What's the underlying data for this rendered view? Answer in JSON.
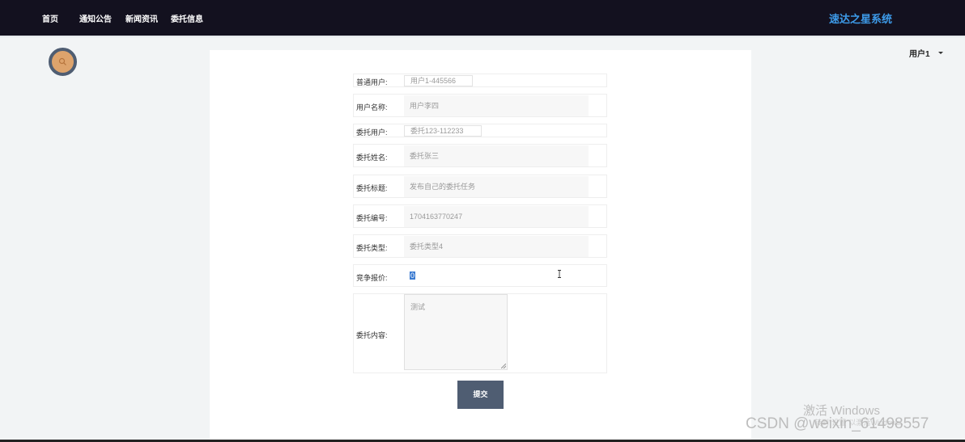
{
  "nav": {
    "items": [
      "首页",
      "通知公告",
      "新闻资讯",
      "委托信息"
    ],
    "brand": "速达之星系统"
  },
  "icons": {
    "search": "search-icon",
    "dropdown": "caret-down-icon",
    "cursor": "text-cursor-icon"
  },
  "colors": {
    "nav_bg": "#13111f",
    "brand": "#3d9be9",
    "button": "#4f5d72",
    "search_circle": "#dda36c"
  },
  "user_menu": {
    "label": "用户1"
  },
  "form": {
    "normal_user": {
      "label": "普通用户:",
      "value": "用户1-445566"
    },
    "user_name": {
      "label": "用户名称:",
      "value": "用户李四"
    },
    "delegate_user": {
      "label": "委托用户:",
      "value": "委托123-112233"
    },
    "delegate_name": {
      "label": "委托姓名:",
      "value": "委托张三"
    },
    "delegate_title": {
      "label": "委托标题:",
      "value": "发布自己的委托任务"
    },
    "delegate_number": {
      "label": "委托编号:",
      "value": "1704163770247"
    },
    "delegate_type": {
      "label": "委托类型:",
      "value": "委托类型4"
    },
    "bid_price": {
      "label": "竞争报价:",
      "value": "0"
    },
    "content": {
      "label": "委托内容:",
      "value": "测试"
    },
    "submit_label": "提交"
  },
  "overlay": {
    "activate_title": "激活 Windows",
    "activate_hint": "转到\"设置\"以激活Windows。",
    "watermark": "CSDN @weixin_61498557"
  }
}
